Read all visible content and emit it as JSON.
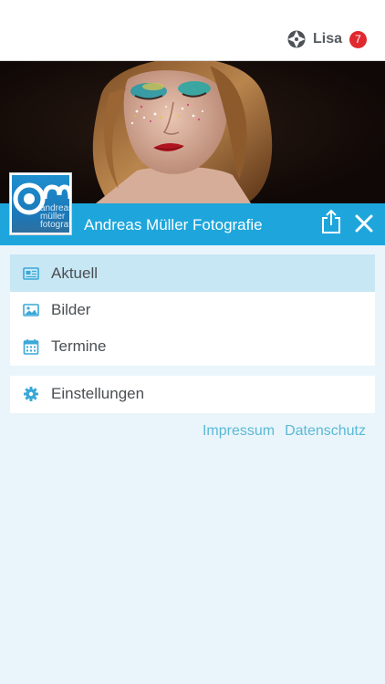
{
  "header": {
    "user_name": "Lisa",
    "notification_count": "7"
  },
  "profile": {
    "title": "Andreas Müller Fotografie",
    "logo_lines": [
      "andreas",
      "müller",
      "fotografie"
    ]
  },
  "menu": {
    "items": [
      {
        "label": "Aktuell",
        "icon": "newspaper-icon",
        "active": true
      },
      {
        "label": "Bilder",
        "icon": "image-icon",
        "active": false
      },
      {
        "label": "Termine",
        "icon": "calendar-icon",
        "active": false
      }
    ],
    "settings_label": "Einstellungen"
  },
  "footer": {
    "impressum": "Impressum",
    "datenschutz": "Datenschutz"
  },
  "colors": {
    "accent": "#1ea6dc",
    "active_row": "#c8e7f5",
    "background": "#eaf5fb",
    "badge": "#e0292e",
    "link": "#5ab9d6"
  }
}
